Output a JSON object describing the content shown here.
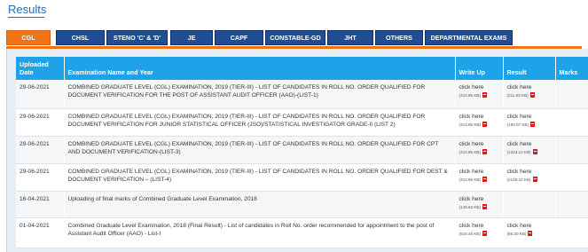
{
  "page": {
    "title": "Results"
  },
  "tabs": [
    {
      "label": "CGL",
      "active": true
    },
    {
      "label": "CHSL"
    },
    {
      "label": "STENO 'C' & 'D'"
    },
    {
      "label": "JE"
    },
    {
      "label": "CAPF"
    },
    {
      "label": "CONSTABLE-GD"
    },
    {
      "label": "JHT"
    },
    {
      "label": "OTHERS"
    },
    {
      "label": "DEPARTMENTAL EXAMS"
    }
  ],
  "table": {
    "headers": {
      "date": "Uploaded Date",
      "name": "Examination Name and Year",
      "writeup": "Write Up",
      "result": "Result",
      "marks": "Marks"
    },
    "rows": [
      {
        "date": "29-06-2021",
        "name": "COMBINED GRADUATE LEVEL (CGL) EXAMINATION, 2019 (TIER-III) - LIST OF CANDIDATES IN ROLL NO. ORDER QUALIFIED FOR DOCUMENT VERIFICATION FOR THE POST OF ASSISTANT AUDIT OFFICER (AAO)-(LIST-1)",
        "writeup_link": "click here",
        "writeup_size": "(313.85 KB)",
        "result_link": "click here",
        "result_size": "(211.53 KB)"
      },
      {
        "date": "29-06-2021",
        "name": "COMBINED GRADUATE LEVEL (CGL) EXAMINATION, 2019 (TIER-III) - LIST OF CANDIDATES IN ROLL NO. ORDER QUALIFIED FOR DOCUMENT VERIFICATION FOR JUNIOR STATISTICAL OFFICER (JSO)/STATISTICAL INVESTIGATOR GRADE-II (LIST 2)",
        "writeup_link": "click here",
        "writeup_size": "(313.85 KB)",
        "result_link": "click here",
        "result_size": "(193.07 KB)"
      },
      {
        "date": "29-06-2021",
        "name": "COMBINED GRADUATE LEVEL (CGL) EXAMINATION, 2019 (TIER-III) - LIST OF CANDIDATES IN ROLL NO. ORDER QUALIFIED FOR CPT AND DOCUMENT VERIFICATION-(LIST-3)",
        "writeup_link": "click here",
        "writeup_size": "(313.85 KB)",
        "result_link": "click here",
        "result_size": "(1323.12 KB)"
      },
      {
        "date": "29-06-2021",
        "name": "COMBINED GRADUATE LEVEL (CGL) EXAMINATION, 2019 (TIER-III) - LIST OF CANDIDATES IN ROLL NO. ORDER QUALIFIED FOR DEST & DOCUMENT VERIFICATION – (LIST-4)",
        "writeup_link": "click here",
        "writeup_size": "(313.85 KB)",
        "result_link": "click here",
        "result_size": "(2146.42 KB)"
      },
      {
        "date": "16-04-2021",
        "name": "Uploading of final marks of Combined Graduate Level Examination, 2018",
        "writeup_link": "click here",
        "writeup_size": "(149.63 KB)",
        "result_link": "",
        "result_size": ""
      },
      {
        "date": "01-04-2021",
        "name": "Combined Graduate Level Examination, 2018 (Final Result) - List of candidates in Roll No. order recommended for appointment to the post of Assistant Audit Officer (AAO) - List-I",
        "writeup_link": "click here",
        "writeup_size": "(519.45 KB)",
        "result_link": "click here",
        "result_size": "(86.30 KB)"
      }
    ]
  },
  "icons": {
    "file": "pdf-icon"
  },
  "colors": {
    "tab": "#1f4e96",
    "tab_active": "#f07318",
    "header": "#1fa3e8",
    "title": "#1f6fb8"
  }
}
